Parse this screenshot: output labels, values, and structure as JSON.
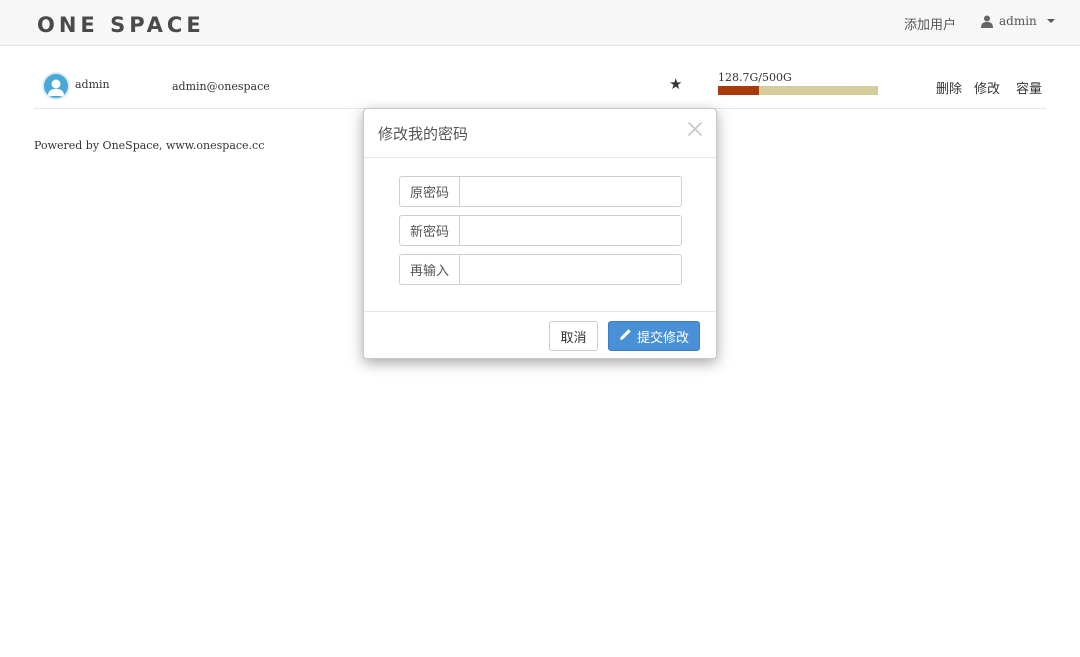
{
  "navbar": {
    "logo": "ONE SPACE",
    "add_user": "添加用户",
    "current_user": "admin"
  },
  "user_row": {
    "name": "admin",
    "email": "admin@onespace",
    "star": "★",
    "quota_text": "128.7G/500G",
    "quota_used_fraction": 0.257,
    "actions": [
      "删除",
      "修改",
      "容量"
    ]
  },
  "footer": {
    "text": "Powered by OneSpace, www.onespace.cc"
  },
  "modal": {
    "title": "修改我的密码",
    "fields": [
      {
        "label": "原密码",
        "value": ""
      },
      {
        "label": "新密码",
        "value": ""
      },
      {
        "label": "再输入",
        "value": ""
      }
    ],
    "cancel_label": "取消",
    "submit_label": "提交修改"
  },
  "colors": {
    "navbar_bg": "#f7f7f7",
    "quota_used": "#a63b0c",
    "quota_free": "#d4cc9a",
    "primary_button": "#4a90d6",
    "avatar": "#4aa8d8"
  },
  "icons": {
    "user": "user-icon",
    "caret": "caret-down-icon",
    "close": "close-icon",
    "pencil": "pencil-icon"
  }
}
